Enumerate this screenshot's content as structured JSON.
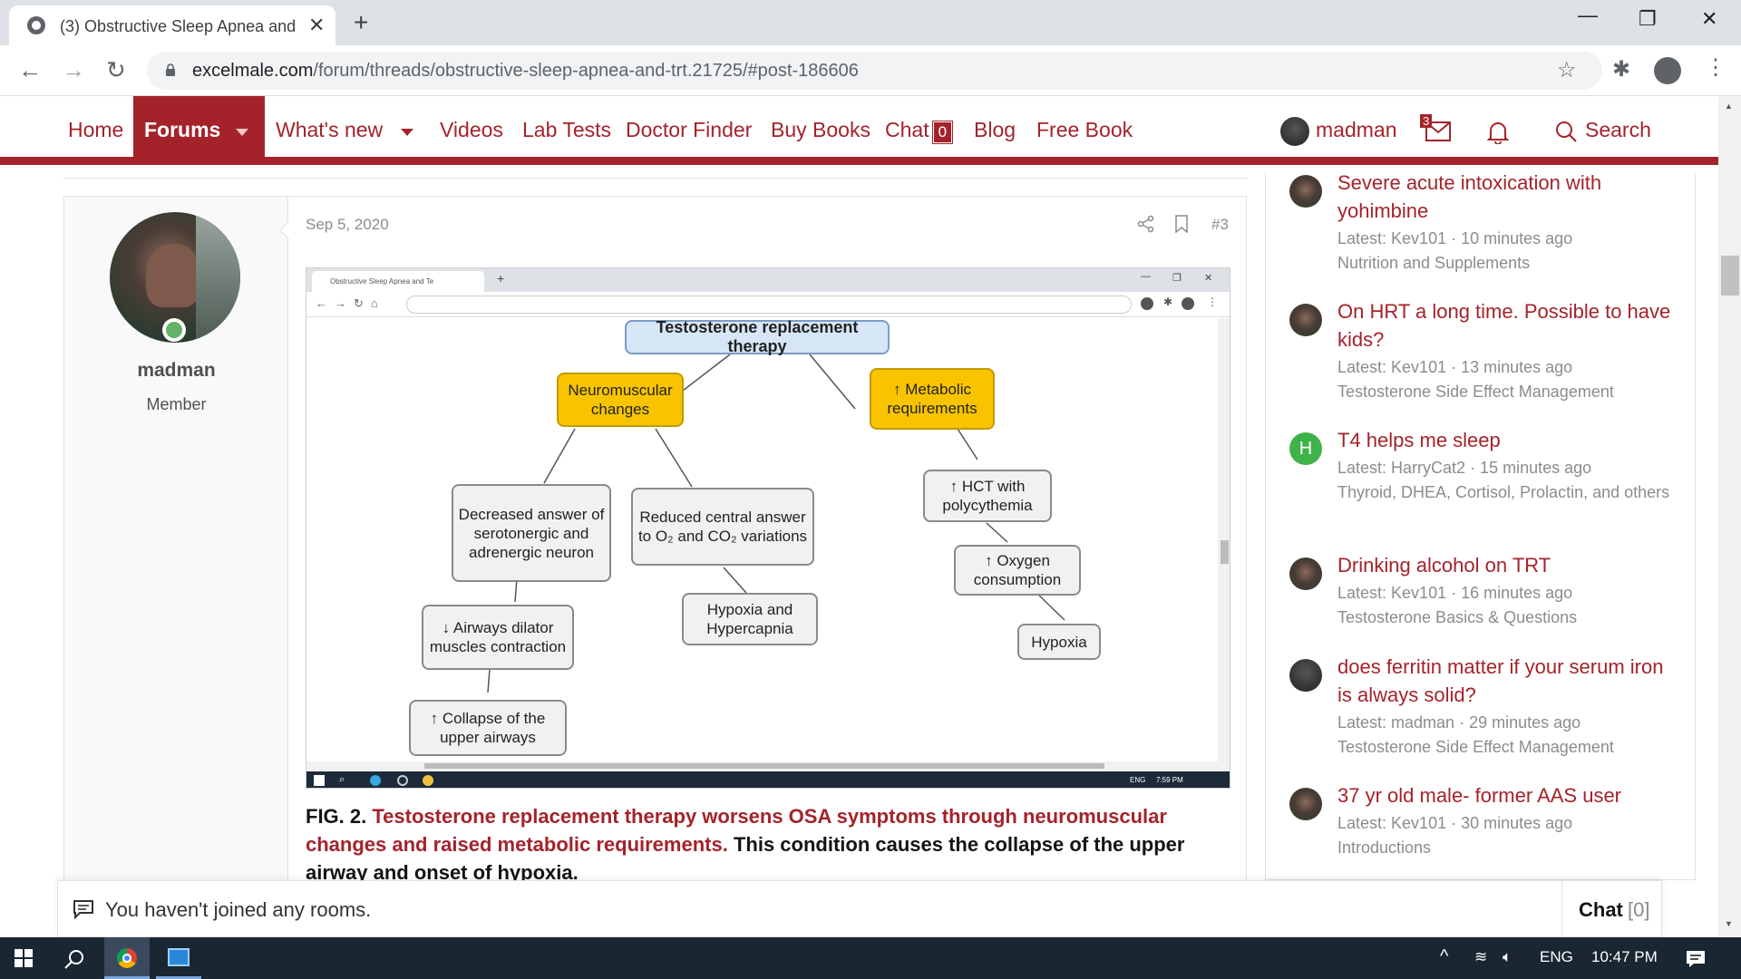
{
  "browser": {
    "tab_title": "(3) Obstructive Sleep Apnea and",
    "tab_close": "✕",
    "new_tab": "+",
    "url_host": "excelmale.com",
    "url_path": "/forum/threads/obstructive-sleep-apnea-and-trt.21725/#post-186606"
  },
  "nav": {
    "home": "Home",
    "forums": "Forums",
    "whats_new": "What's new",
    "videos": "Videos",
    "lab_tests": "Lab Tests",
    "doctor_finder": "Doctor Finder",
    "buy_books": "Buy Books",
    "chat": "Chat",
    "chat_count": "0",
    "blog": "Blog",
    "free_book": "Free Book",
    "username": "madman",
    "mail_count": "3",
    "search": "Search"
  },
  "post": {
    "date": "Sep 5, 2020",
    "number": "#3",
    "author": "madman",
    "author_title": "Member",
    "caption_prefix": "FIG. 2.",
    "caption_highlight": "Testosterone replacement therapy worsens OSA symptoms through neuromuscular changes and raised metabolic requirements.",
    "caption_rest": "This condition causes the collapse of the upper airway and onset of hypoxia."
  },
  "embed": {
    "tab_title": "Obstructive Sleep Apnea and Te",
    "taskbar_lang": "ENG",
    "taskbar_time": "7:59 PM"
  },
  "figure": {
    "root": "Testosterone replacement therapy",
    "neuro": "Neuromuscular changes",
    "metabolic": "↑ Metabolic requirements",
    "decreased": "Decreased answer of serotonergic and adrenergic neuron",
    "reduced": "Reduced central answer to O₂ and CO₂ variations",
    "hct": "↑ HCT with polycythemia",
    "airways": "↓ Airways dilator muscles contraction",
    "hypoxia_hyper": "Hypoxia and Hypercapnia",
    "oxygen": "↑ Oxygen consumption",
    "hypoxia": "Hypoxia",
    "collapse": "↑ Collapse of the upper airways"
  },
  "sidebar": {
    "items": [
      {
        "title": "Severe acute intoxication with yohimbine",
        "latest": "Latest: Kev101 · 10 minutes ago",
        "forum": "Nutrition and Supplements"
      },
      {
        "title": "On HRT a long time. Possible to have kids?",
        "latest": "Latest: Kev101 · 13 minutes ago",
        "forum": "Testosterone Side Effect Management"
      },
      {
        "title": "T4 helps me sleep",
        "latest": "Latest: HarryCat2 · 15 minutes ago",
        "forum": "Thyroid, DHEA, Cortisol, Prolactin, and others",
        "avatar_letter": "H"
      },
      {
        "title": "Drinking alcohol on TRT",
        "latest": "Latest: Kev101 · 16 minutes ago",
        "forum": "Testosterone Basics & Questions"
      },
      {
        "title": "does ferritin matter if your serum iron is always solid?",
        "latest": "Latest: madman · 29 minutes ago",
        "forum": "Testosterone Side Effect Management"
      },
      {
        "title": "37 yr old male- former AAS user",
        "latest": "Latest: Kev101 · 30 minutes ago",
        "forum": "Introductions"
      }
    ]
  },
  "chatbar": {
    "message": "You haven't joined any rooms.",
    "tab_label": "Chat",
    "tab_count": "[0]"
  },
  "taskbar": {
    "lang": "ENG",
    "time": "10:47 PM"
  },
  "colors": {
    "brand": "#a4232b",
    "highlight_box": "#f8c400"
  }
}
